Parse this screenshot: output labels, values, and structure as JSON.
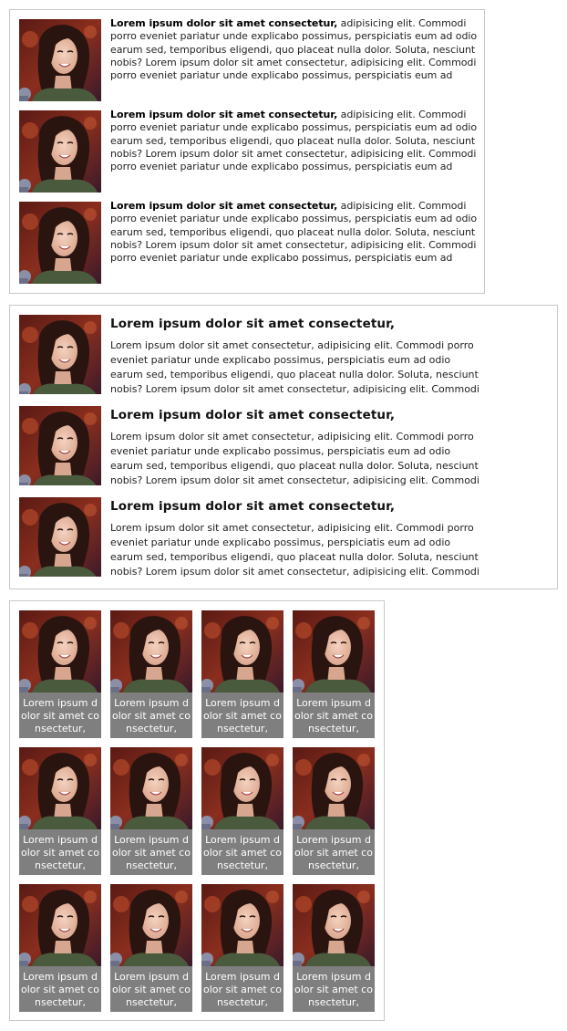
{
  "section1": {
    "items": [
      {
        "title": "Lorem ipsum dolor sit amet consectetur,",
        "body": "adipisicing elit. Commodi porro eveniet pariatur unde explicabo possimus, perspiciatis eum ad odio earum sed, temporibus eligendi, quo placeat nulla dolor. Soluta, nesciunt nobis? Lorem ipsum dolor sit amet consectetur, adipisicing elit. Commodi porro eveniet pariatur unde explicabo possimus, perspiciatis eum ad"
      },
      {
        "title": "Lorem ipsum dolor sit amet consectetur,",
        "body": "adipisicing elit. Commodi porro eveniet pariatur unde explicabo possimus, perspiciatis eum ad odio earum sed, temporibus eligendi, quo placeat nulla dolor. Soluta, nesciunt nobis? Lorem ipsum dolor sit amet consectetur, adipisicing elit. Commodi porro eveniet pariatur unde explicabo possimus, perspiciatis eum ad"
      },
      {
        "title": "Lorem ipsum dolor sit amet consectetur,",
        "body": "adipisicing elit. Commodi porro eveniet pariatur unde explicabo possimus, perspiciatis eum ad odio earum sed, temporibus eligendi, quo placeat nulla dolor. Soluta, nesciunt nobis? Lorem ipsum dolor sit amet consectetur, adipisicing elit. Commodi porro eveniet pariatur unde explicabo possimus, perspiciatis eum ad"
      }
    ]
  },
  "section2": {
    "items": [
      {
        "title": "Lorem ipsum dolor sit amet consectetur,",
        "body": "Lorem ipsum dolor sit amet consectetur, adipisicing elit. Commodi porro eveniet pariatur unde explicabo possimus, perspiciatis eum ad odio earum sed, temporibus eligendi, quo placeat nulla dolor. Soluta, nesciunt nobis? Lorem ipsum dolor sit amet consectetur, adipisicing elit. Commodi"
      },
      {
        "title": "Lorem ipsum dolor sit amet consectetur,",
        "body": "Lorem ipsum dolor sit amet consectetur, adipisicing elit. Commodi porro eveniet pariatur unde explicabo possimus, perspiciatis eum ad odio earum sed, temporibus eligendi, quo placeat nulla dolor. Soluta, nesciunt nobis? Lorem ipsum dolor sit amet consectetur, adipisicing elit. Commodi"
      },
      {
        "title": "Lorem ipsum dolor sit amet consectetur,",
        "body": "Lorem ipsum dolor sit amet consectetur, adipisicing elit. Commodi porro eveniet pariatur unde explicabo possimus, perspiciatis eum ad odio earum sed, temporibus eligendi, quo placeat nulla dolor. Soluta, nesciunt nobis? Lorem ipsum dolor sit amet consectetur, adipisicing elit. Commodi"
      }
    ]
  },
  "grid": {
    "captions": [
      "Lorem ipsum dolor sit amet consectetur,",
      "Lorem ipsum dolor sit amet consectetur,",
      "Lorem ipsum dolor sit amet consectetur,",
      "Lorem ipsum dolor sit amet consectetur,",
      "Lorem ipsum dolor sit amet consectetur,",
      "Lorem ipsum dolor sit amet consectetur,",
      "Lorem ipsum dolor sit amet consectetur,",
      "Lorem ipsum dolor sit amet consectetur,",
      "Lorem ipsum dolor sit amet consectetur,",
      "Lorem ipsum dolor sit amet consectetur,",
      "Lorem ipsum dolor sit amet consectetur,",
      "Lorem ipsum dolor sit amet consectetur,"
    ]
  },
  "colors": {
    "border": "#c8c8c8",
    "caption_bg": "#7f7f7f",
    "caption_text": "#ffffff"
  }
}
